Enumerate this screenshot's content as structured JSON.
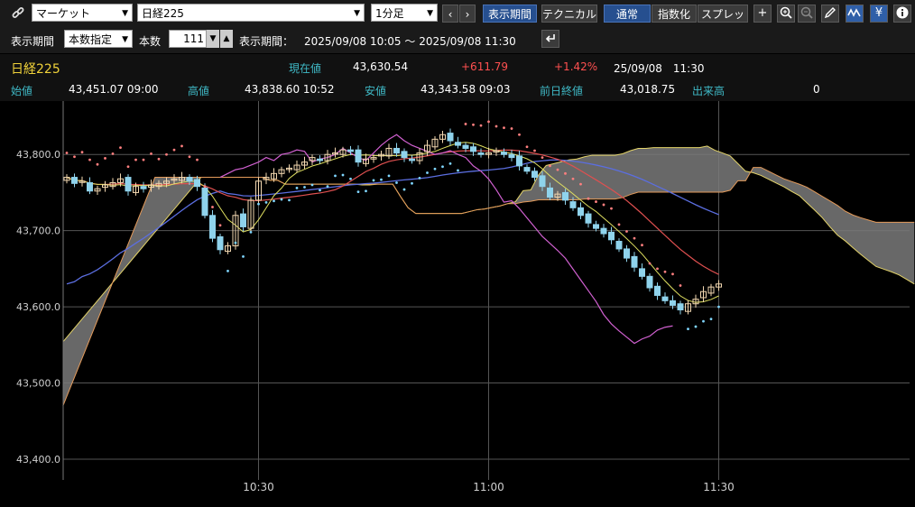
{
  "toolbar": {
    "market_select": "マーケット",
    "symbol_select": "日経225",
    "interval_select": "1分足",
    "prev": "‹",
    "next": "›",
    "period_button": "表示期間",
    "technical_button": "テクニカル",
    "normal_button": "通常",
    "index_button": "指数化",
    "spread_button": "スプレッド",
    "yen_button": "¥"
  },
  "range_bar": {
    "period_label": "表示期間",
    "period_select": "本数指定",
    "count_label": "本数",
    "count_value": "111",
    "display_label": "表示期間：",
    "display_range": "2025/09/08 10:05 〜 2025/09/08 11:30"
  },
  "quote": {
    "name": "日経225",
    "current_label": "現在値",
    "current_value": "43,630.54",
    "change": "+611.79",
    "change_pct": "+1.42%",
    "datetime": "25/09/08　11:30",
    "open_label": "始値",
    "open_value": "43,451.07 09:00",
    "high_label": "高値",
    "high_value": "43,838.60 10:52",
    "low_label": "安値",
    "low_value": "43,343.58 09:03",
    "prev_close_label": "前日終値",
    "prev_close_value": "43,018.75",
    "volume_label": "出来高",
    "volume_value": "0"
  },
  "chart_data": {
    "type": "candlestick",
    "ylim": [
      43400,
      43850
    ],
    "y_ticks": [
      "43,800.0",
      "43,700.0",
      "43,600.0",
      "43,500.0",
      "43,400.0"
    ],
    "y_tick_values": [
      43800,
      43700,
      43600,
      43500,
      43400
    ],
    "x_ticks": [
      "10:30",
      "11:00",
      "11:30"
    ],
    "x_tick_index": [
      25,
      55,
      85
    ],
    "bars": 111,
    "colors": {
      "up": "#f2d7b0",
      "down": "#8fd3ec",
      "cloud": "#7a7a7a",
      "cloud_edge1": "#e39a5a",
      "cloud_edge2": "#e3d36a",
      "lagging": "#d060d0",
      "ma_long": "#5b6ee0",
      "ma_mid": "#e05050",
      "ma_short": "#e0e060",
      "sar_up": "#7fd6ff",
      "sar_down": "#ff7f7f"
    },
    "closes": [
      43770,
      43762,
      43765,
      43752,
      43755,
      43760,
      43763,
      43768,
      43752,
      43758,
      43755,
      43760,
      43762,
      43765,
      43768,
      43770,
      43765,
      43758,
      43720,
      43690,
      43675,
      43680,
      43720,
      43705,
      43740,
      43765,
      43770,
      43775,
      43780,
      43782,
      43786,
      43790,
      43796,
      43792,
      43800,
      43802,
      43806,
      43804,
      43790,
      43794,
      43796,
      43800,
      43808,
      43802,
      43796,
      43792,
      43802,
      43812,
      43820,
      43826,
      43818,
      43812,
      43808,
      43804,
      43800,
      43802,
      43805,
      43800,
      43796,
      43785,
      43778,
      43770,
      43758,
      43744,
      43748,
      43740,
      43730,
      43720,
      43710,
      43703,
      43696,
      43688,
      43676,
      43664,
      43652,
      43640,
      43625,
      43615,
      43608,
      43602,
      43596,
      43604,
      43610,
      43620,
      43626,
      43630
    ]
  }
}
